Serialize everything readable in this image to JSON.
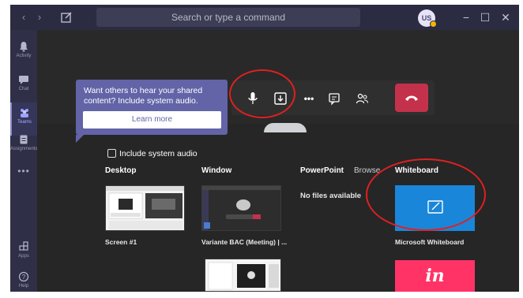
{
  "titlebar": {
    "search_placeholder": "Search or type a command",
    "back_glyph": "‹",
    "forward_glyph": "›",
    "avatar_initials": "US",
    "minimize_glyph": "−",
    "maximize_glyph": "☐",
    "close_glyph": "✕"
  },
  "rail": {
    "items": [
      {
        "label": "Activity",
        "icon": "bell-icon"
      },
      {
        "label": "Chat",
        "icon": "chat-icon"
      },
      {
        "label": "Teams",
        "icon": "teams-icon"
      },
      {
        "label": "Assignments",
        "icon": "assignments-icon"
      }
    ],
    "more_label": "•••",
    "apps_label": "Apps",
    "help_label": "Help"
  },
  "call_controls": {
    "more_glyph": "•••",
    "icons": [
      "microphone-icon",
      "share-tray-icon",
      "more-options-icon",
      "chat-icon",
      "participants-icon",
      "hang-up-icon"
    ]
  },
  "tooltip": {
    "text": "Want others to hear your shared content? Include system audio.",
    "button_label": "Learn more"
  },
  "share_tray": {
    "include_audio_label": "Include system audio",
    "columns": {
      "desktop": "Desktop",
      "window": "Window",
      "powerpoint": "PowerPoint",
      "browse": "Browse",
      "whiteboard": "Whiteboard"
    },
    "desktop_items": [
      {
        "label": "Screen #1"
      }
    ],
    "window_items": [
      {
        "label": "Variante BAC (Meeting) | ..."
      }
    ],
    "powerpoint_empty": "No files available",
    "whiteboard_items": [
      {
        "label": "Microsoft Whiteboard"
      },
      {
        "label": "in"
      }
    ]
  },
  "colors": {
    "accent": "#6264a7",
    "hangup": "#c4314b",
    "whiteboard": "#1a86d9",
    "invision": "#ff3366",
    "annotation": "#e02020"
  }
}
